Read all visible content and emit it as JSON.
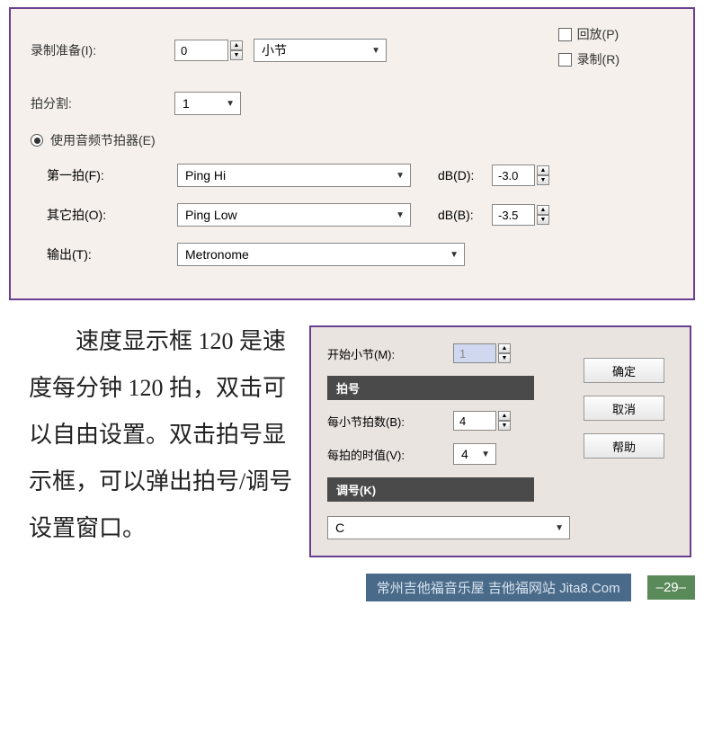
{
  "top": {
    "record_prepare_label": "录制准备(I):",
    "record_prepare_value": "0",
    "record_prepare_placeholder": "0",
    "measure_label": "小节",
    "playback_label": "回放(P)",
    "record_label": "录制(R)",
    "beat_division_label": "拍分割:",
    "beat_division_value": "1",
    "audio_metronome_label": "使用音频节拍器(E)",
    "first_beat_label": "第一拍(F):",
    "first_beat_value": "Ping Hi",
    "db_d_label": "dB(D):",
    "db_d_value": "-3.0",
    "other_beat_label": "其它拍(O):",
    "other_beat_value": "Ping Low",
    "db_b_label": "dB(B):",
    "db_b_value": "-3.5",
    "output_label": "输出(T):",
    "output_value": "Metronome"
  },
  "body_text": "速度显示框 120 是速度每分钟 120 拍，双击可以自由设置。双击拍号显示框，可以弹出拍号/调号设置窗口。",
  "dialog": {
    "start_measure_label": "开始小节(M):",
    "start_measure_value": "1",
    "time_sig_header": "拍号",
    "beats_per_measure_label": "每小节拍数(B):",
    "beats_per_measure_value": "4",
    "beat_value_label": "每拍的时值(V):",
    "beat_value_value": "4",
    "key_sig_header": "调号(K)",
    "key_value": "C",
    "ok_label": "确定",
    "cancel_label": "取消",
    "help_label": "帮助"
  },
  "footer": {
    "credits": "常州吉他福音乐屋  吉他福网站 Jita8.Com",
    "page": "–29–"
  }
}
